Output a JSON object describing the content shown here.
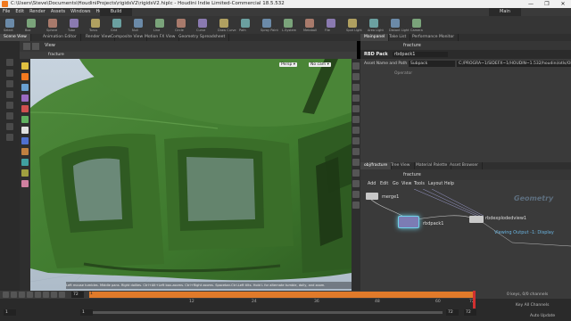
{
  "window": {
    "title": "C:\\Users\\Steve\\Documents\\HoudiniProjects\\rigidsV2\\rigidsV2.hiplc - Houdini Indie Limited-Commercial 18.5.532",
    "controls": [
      "—",
      "❐",
      "✕"
    ]
  },
  "menubar": {
    "items": [
      "File",
      "Edit",
      "Render",
      "Assets",
      "Windows",
      "Help"
    ],
    "build_label": "Build",
    "desktop_label": "Main"
  },
  "shelf": {
    "tools": [
      "Select",
      "Box",
      "Sphere",
      "Tube",
      "Torus",
      "Grid",
      "Null",
      "Line",
      "Circle",
      "Curve",
      "Draw Curve",
      "Path",
      "Spray Paint",
      "L-System",
      "Metaball",
      "File",
      "Spot Light",
      "Area Light",
      "Distant Light",
      "Camera"
    ]
  },
  "pane_tabs": [
    "Scene View",
    "Animation Editor",
    "Render View",
    "Composite View",
    "Motion FX View",
    "Geometry Spreadsheet"
  ],
  "viewport": {
    "tab_label": "View",
    "network_label": "fracture",
    "persp_label": "Persp ▾",
    "cam_label": "No cam ▾",
    "status_message": "Left mouse tumbles. Middle pans. Right dollies. Ctrl+Alt+Left box-zooms. Ctrl+Right zooms. Spacebar-Ctrl-Left tilts. Hold L for alternate tumble, dolly, and zoom."
  },
  "params": {
    "tabs": [
      "Mainpanel",
      "Take List",
      "Performance Monitor"
    ],
    "path_label": "fracture",
    "node_type": "RBD Pack",
    "node_name": "rbdpack1",
    "row_label": "Asset Name and Path",
    "row_value_left": "Subpack",
    "row_value_right": "C:/PROGRA~1/SIDEFX~1/HOUDIN~1.532/houdini/otls/OPlibSop.hda",
    "row2_label": "Operator"
  },
  "network": {
    "tabs": [
      "obj/fracture",
      "Tree View",
      "Material Palette",
      "Asset Browser"
    ],
    "path_label": "fracture",
    "menu": [
      "Add",
      "Edit",
      "Go",
      "View",
      "Tools",
      "Layout",
      "Help"
    ],
    "context_label": "Geometry",
    "nodes": [
      {
        "name": "merge1"
      },
      {
        "name": "rbdpack1"
      },
      {
        "name": "rbdexplodedview1"
      }
    ],
    "output_caption": "Viewing Output -1: Display"
  },
  "timeline": {
    "frame_start": "1",
    "frame_end": "72",
    "current_frame": "72",
    "ticks": [
      "12",
      "24",
      "36",
      "48",
      "60",
      "72"
    ],
    "keys_label": "0 keys, 0/0 channels",
    "key_channels_label": "Key All Channels",
    "auto_update_label": "Auto Update",
    "frame_range_a": "1",
    "frame_range_b": "1",
    "end_field": "72",
    "end_field2": "72"
  },
  "colors": {
    "accent": "#f37a1f",
    "helicopter": "#3f7a2e",
    "viewport_bg": "#b9c7d4"
  }
}
